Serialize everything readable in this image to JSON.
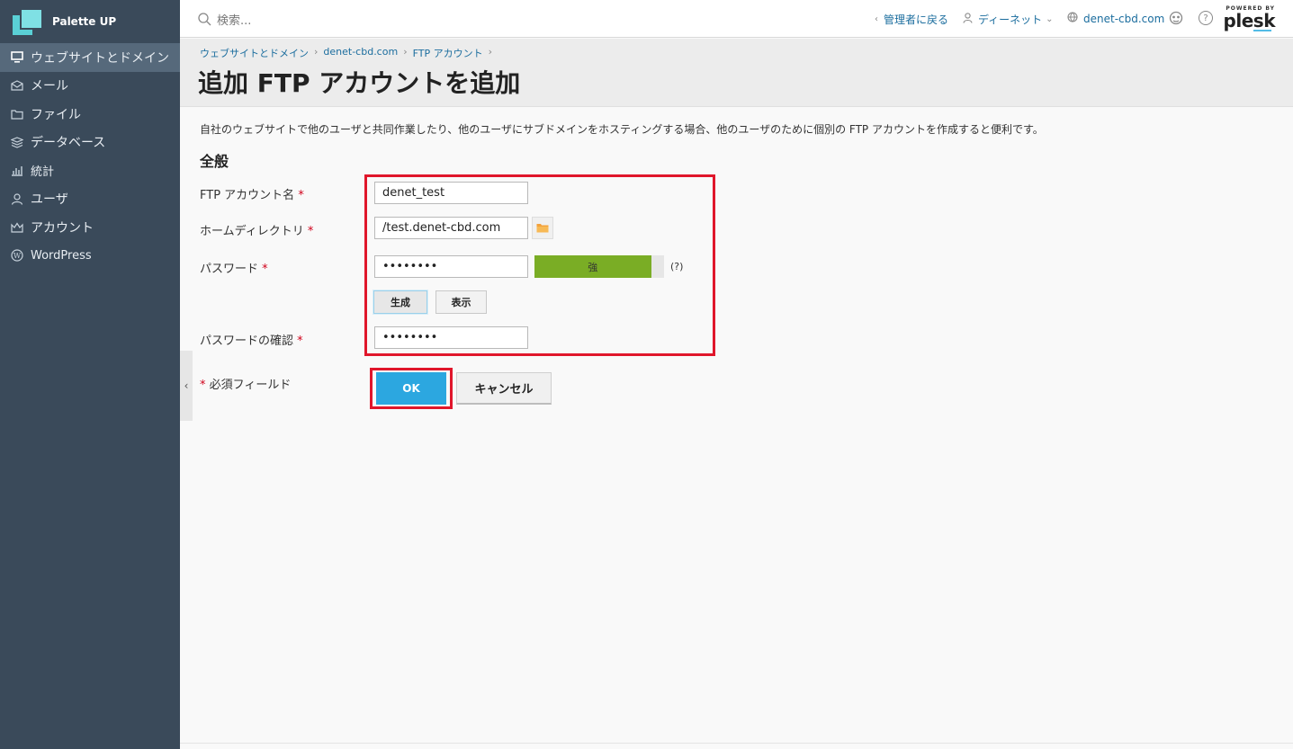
{
  "brand": {
    "name": "Palette UP"
  },
  "sidebar": {
    "items": [
      {
        "label": "ウェブサイトとドメイン",
        "icon": "monitor-icon",
        "active": true
      },
      {
        "label": "メール",
        "icon": "mail-icon"
      },
      {
        "label": "ファイル",
        "icon": "folder-icon"
      },
      {
        "label": "データベース",
        "icon": "database-icon"
      },
      {
        "label": "統計",
        "icon": "bar-chart-icon"
      },
      {
        "label": "ユーザ",
        "icon": "user-icon"
      },
      {
        "label": "アカウント",
        "icon": "crown-icon"
      },
      {
        "label": "WordPress",
        "icon": "wordpress-icon"
      }
    ]
  },
  "header": {
    "search_placeholder": "検索...",
    "back_admin": "管理者に戻る",
    "user": "ディーネット",
    "domain": "denet-cbd.com",
    "plesk_powered": "POWERED BY",
    "plesk_brand": "plesk"
  },
  "breadcrumb": {
    "items": [
      "ウェブサイトとドメイン",
      "denet-cbd.com",
      "FTP アカウント"
    ]
  },
  "page": {
    "title": "追加 FTP アカウントを追加",
    "intro": "自社のウェブサイトで他のユーザと共同作業したり、他のユーザにサブドメインをホスティングする場合、他のユーザのために個別の FTP アカウントを作成すると便利です。",
    "section_title": "全般"
  },
  "form": {
    "ftp_account_label": "FTP アカウント名",
    "ftp_account_value": "denet_test",
    "home_dir_label": "ホームディレクトリ",
    "home_dir_value": "/test.denet-cbd.com",
    "password_label": "パスワード",
    "password_value": "••••••••",
    "strength_label": "強",
    "strength_level": 0.9,
    "help": "(?)",
    "generate_button": "生成",
    "show_button": "表示",
    "confirm_label": "パスワードの確認",
    "confirm_value": "••••••••",
    "required_mark": "*",
    "required_note": "必須フィールド",
    "ok_button": "OK",
    "cancel_button": "キャンセル"
  },
  "colors": {
    "sidebar_bg": "#3a4a5a",
    "accent": "#2ca7e0",
    "highlight": "#e0162b",
    "strength": "#7aad25"
  }
}
